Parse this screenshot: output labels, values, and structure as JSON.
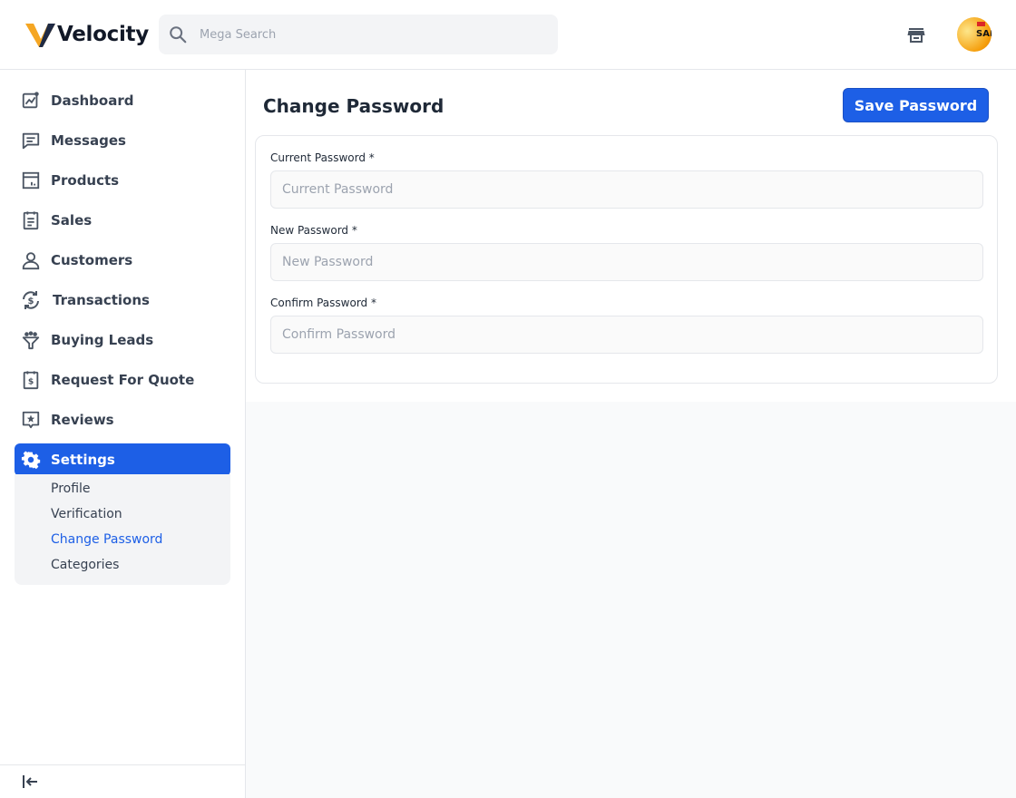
{
  "header": {
    "brand": "Velocity",
    "search": {
      "placeholder": "Mega Search",
      "value": ""
    },
    "avatar_text": "SAI"
  },
  "sidebar": {
    "items": [
      {
        "label": "Dashboard",
        "icon": "dashboard-chart-icon"
      },
      {
        "label": "Messages",
        "icon": "message-icon"
      },
      {
        "label": "Products",
        "icon": "products-icon"
      },
      {
        "label": "Sales",
        "icon": "sales-receipt-icon"
      },
      {
        "label": "Customers",
        "icon": "customer-icon"
      },
      {
        "label": "Transactions",
        "icon": "transactions-icon"
      },
      {
        "label": "Buying Leads",
        "icon": "buying-leads-icon"
      },
      {
        "label": "Request For Quote",
        "icon": "quote-icon"
      },
      {
        "label": "Reviews",
        "icon": "review-star-icon"
      },
      {
        "label": "Settings",
        "icon": "gear-icon",
        "active": true
      }
    ],
    "settings_submenu": [
      {
        "label": "Profile"
      },
      {
        "label": "Verification"
      },
      {
        "label": "Change Password",
        "active": true
      },
      {
        "label": "Categories"
      }
    ]
  },
  "main": {
    "title": "Change Password",
    "save_label": "Save Password",
    "fields": [
      {
        "label": "Current Password *",
        "placeholder": "Current Password",
        "value": ""
      },
      {
        "label": "New Password *",
        "placeholder": "New Password",
        "value": ""
      },
      {
        "label": "Confirm Password *",
        "placeholder": "Confirm Password",
        "value": ""
      }
    ]
  },
  "colors": {
    "accent": "#1d5fe6",
    "logo_orange": "#f5a623",
    "logo_dark": "#1f2a44"
  }
}
